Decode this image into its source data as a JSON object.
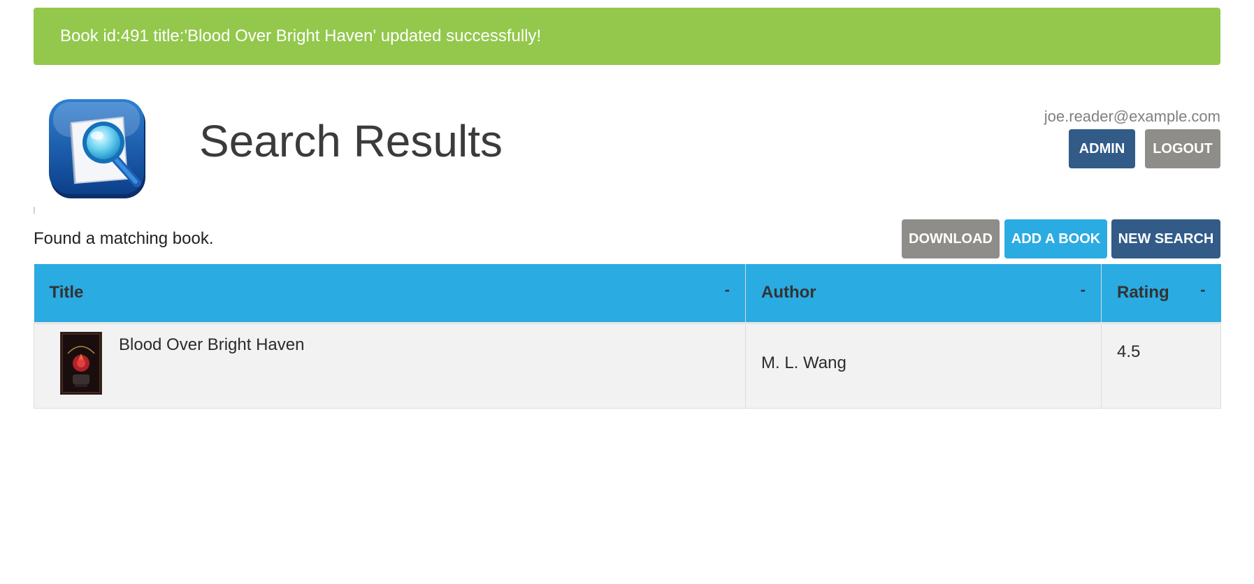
{
  "flash": {
    "message": "Book id:491 title:'Blood Over Bright Haven' updated successfully!",
    "color": "#93c84c"
  },
  "header": {
    "logo_icon": "magnifier-document-icon",
    "title": "Search Results",
    "user_email": "joe.reader@example.com",
    "admin_label": "ADMIN",
    "logout_label": "LOGOUT"
  },
  "results": {
    "message": "Found a matching book.",
    "download_label": "DOWNLOAD",
    "add_label": "ADD A BOOK",
    "new_search_label": "NEW SEARCH",
    "columns": [
      {
        "label": "Title",
        "sort": "-"
      },
      {
        "label": "Author",
        "sort": "-"
      },
      {
        "label": "Rating",
        "sort": "-"
      }
    ],
    "rows": [
      {
        "title": "Blood Over Bright Haven",
        "author": "M. L. Wang",
        "rating": "4.5",
        "cover_icon": "book-cover-thumbnail"
      }
    ]
  },
  "colors": {
    "primary_dark": "#325b88",
    "accent_blue": "#2aabe2",
    "neutral_gray": "#8f8d89",
    "success_green": "#93c84c"
  }
}
